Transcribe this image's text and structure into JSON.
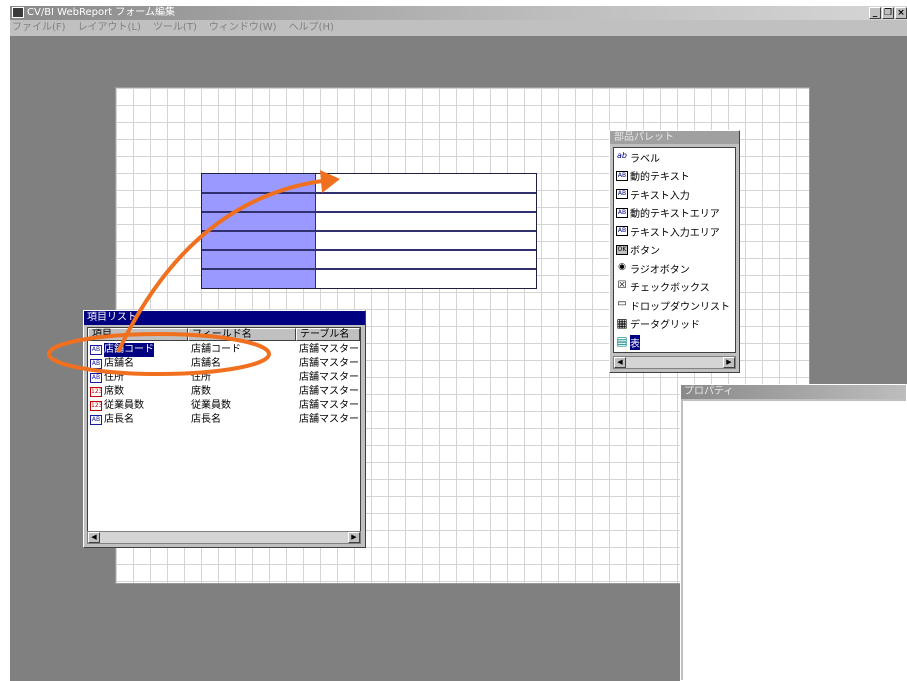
{
  "window": {
    "title": "CV/BI WebReport フォーム編集",
    "buttons": [
      "_",
      "❐",
      "×"
    ]
  },
  "menubar": [
    "ファイル(F)",
    "レイアウト(L)",
    "ツール(T)",
    "ウィンドウ(W)",
    "ヘルプ(H)"
  ],
  "palette": {
    "title": "部品パレット",
    "items": [
      {
        "icon": "ab",
        "label": "ラベル"
      },
      {
        "icon": "AB",
        "label": "動的テキスト"
      },
      {
        "icon": "AB",
        "label": "テキスト入力"
      },
      {
        "icon": "AB",
        "label": "動的テキストエリア"
      },
      {
        "icon": "AB",
        "label": "テキスト入力エリア"
      },
      {
        "icon": "OK",
        "label": "ボタン"
      },
      {
        "icon": "◉",
        "label": "ラジオボタン"
      },
      {
        "icon": "☒",
        "label": "チェックボックス"
      },
      {
        "icon": "▭",
        "label": "ドロップダウンリスト"
      },
      {
        "icon": "▦",
        "label": "データグリッド"
      },
      {
        "icon": "▤",
        "label": "表"
      }
    ]
  },
  "itemlist": {
    "title": "項目リスト",
    "columns": [
      "項目",
      "フィールド名",
      "テーブル名"
    ],
    "rows": [
      {
        "icon": "AB",
        "item": "店舗コード",
        "field": "店舗コード",
        "table": "店舗マスター"
      },
      {
        "icon": "AB",
        "item": "店舗名",
        "field": "店舗名",
        "table": "店舗マスター"
      },
      {
        "icon": "AB",
        "item": "住所",
        "field": "住所",
        "table": "店舗マスター"
      },
      {
        "icon": "123",
        "item": "席数",
        "field": "席数",
        "table": "店舗マスター"
      },
      {
        "icon": "123",
        "item": "従業員数",
        "field": "従業員数",
        "table": "店舗マスター"
      },
      {
        "icon": "AB",
        "item": "店長名",
        "field": "店長名",
        "table": "店舗マスター"
      }
    ]
  },
  "properties": {
    "title": "プロパティ"
  },
  "colors": {
    "selection": "#000080",
    "table_header": "#9999ff",
    "annotation": "#f07020"
  }
}
